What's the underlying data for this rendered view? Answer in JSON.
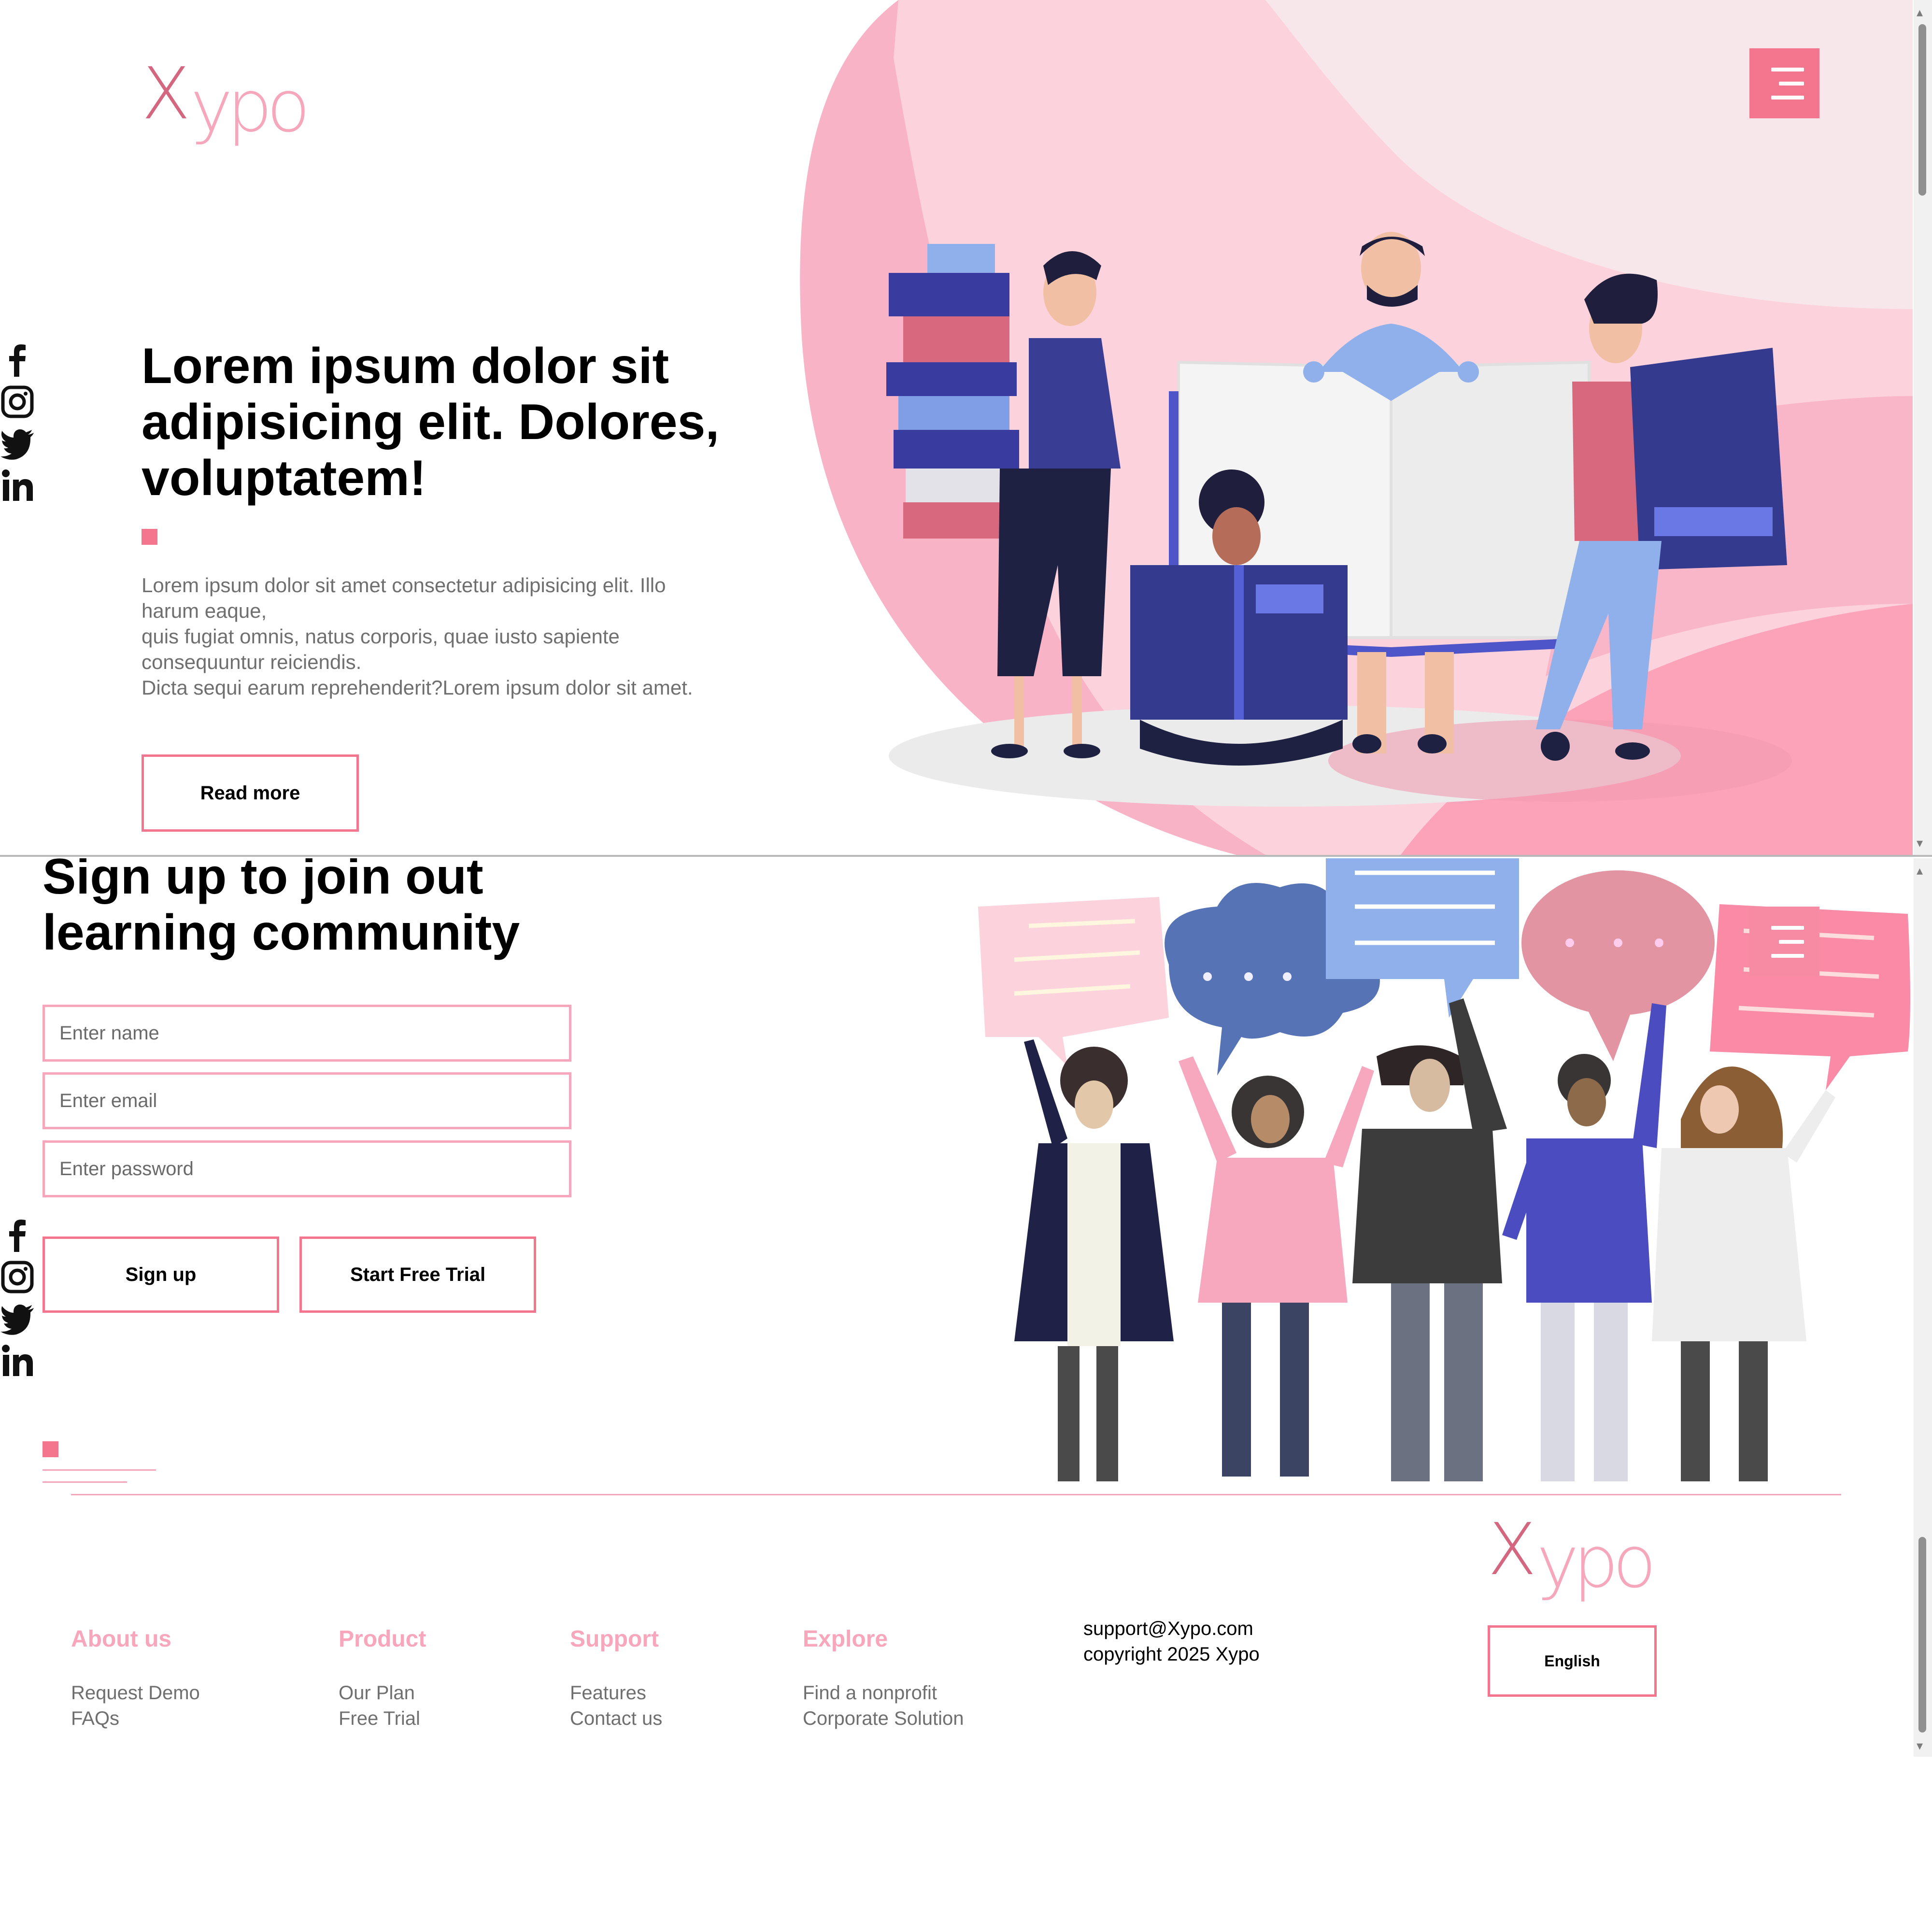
{
  "brand": {
    "logo_x": "X",
    "logo_rest": "ypo"
  },
  "hero": {
    "title": "Lorem ipsum dolor sit adipisicing elit. Dolores, voluptatem!",
    "text_lines": [
      "Lorem ipsum dolor sit amet consectetur adipisicing elit. Illo harum eaque,",
      "quis fugiat omnis, natus corporis, quae iusto sapiente consequuntur reiciendis.",
      "Dicta sequi earum reprehenderit?Lorem ipsum dolor sit amet."
    ],
    "read_more": "Read more"
  },
  "signup": {
    "title": "Sign up to join out learning community",
    "name_placeholder": "Enter name",
    "email_placeholder": "Enter email",
    "password_placeholder": "Enter password",
    "signup_label": "Sign up",
    "trial_label": "Start Free Trial"
  },
  "footer": {
    "columns": [
      {
        "heading": "About us",
        "links": [
          "Request Demo",
          "FAQs"
        ]
      },
      {
        "heading": "Product",
        "links": [
          "Our Plan",
          "Free Trial"
        ]
      },
      {
        "heading": "Support",
        "links": [
          "Features",
          "Contact us"
        ]
      },
      {
        "heading": "Explore",
        "links": [
          "Find a nonprofit",
          "Corporate Solution"
        ]
      }
    ],
    "email": "support@Xypo.com",
    "copyright": "copyright 2025 Xypo",
    "language": "English"
  },
  "social_icons": [
    "facebook-icon",
    "instagram-icon",
    "twitter-icon",
    "linkedin-icon"
  ],
  "colors": {
    "accent": "#f4768e",
    "accent_light": "#f7a6bb",
    "logo_dark": "#d4677f",
    "text_grey": "#6f6f6f"
  }
}
